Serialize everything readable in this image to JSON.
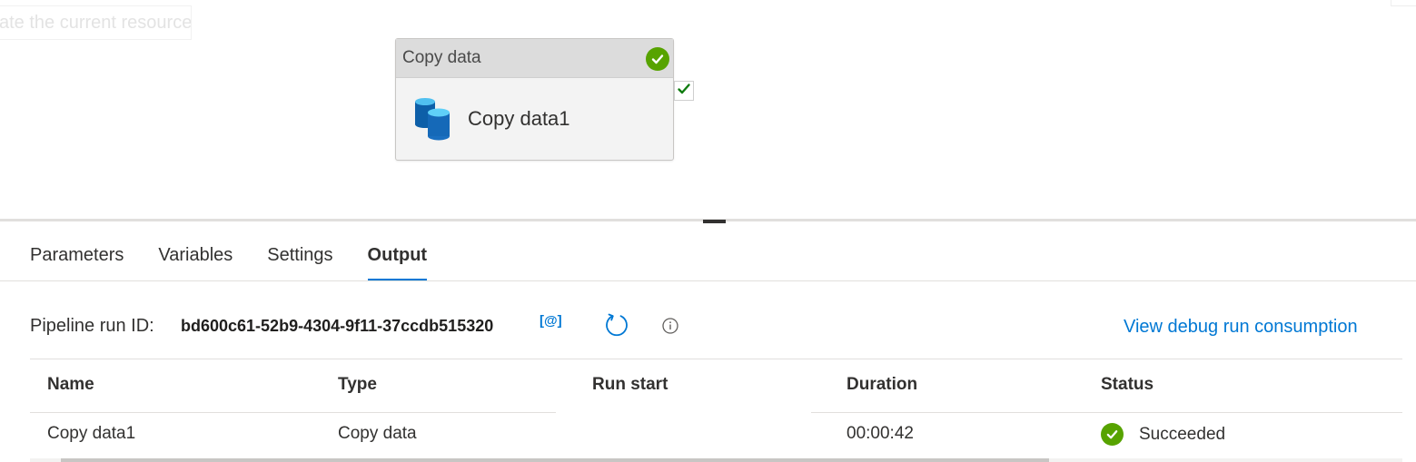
{
  "canvas": {
    "ghost_button_text": "ate the current resource",
    "activity": {
      "type_label": "Copy data",
      "name": "Copy data1",
      "status_icon": "success-check-icon",
      "activity_icon": "database-copy-icon"
    },
    "success_port_icon": "checkmark-icon"
  },
  "tabs": [
    {
      "label": "Parameters"
    },
    {
      "label": "Variables"
    },
    {
      "label": "Settings"
    },
    {
      "label": "Output"
    }
  ],
  "active_tab": "Output",
  "output": {
    "run_id_label": "Pipeline run ID:",
    "run_id_value": "bd600c61-52b9-4304-9f11-37ccdb515320",
    "copy_expression_label": "[@]",
    "refresh_icon": "refresh-icon",
    "info_icon": "info-icon",
    "consumption_link": "View debug run consumption"
  },
  "table": {
    "columns": [
      "Name",
      "Type",
      "Run start",
      "Duration",
      "Status"
    ],
    "rows": [
      {
        "name": "Copy data1",
        "type": "Copy data",
        "run_start": "",
        "duration": "00:00:42",
        "status": "Succeeded"
      }
    ]
  },
  "colors": {
    "accent": "#0078d4",
    "success": "#57a300",
    "text": "#323130"
  }
}
